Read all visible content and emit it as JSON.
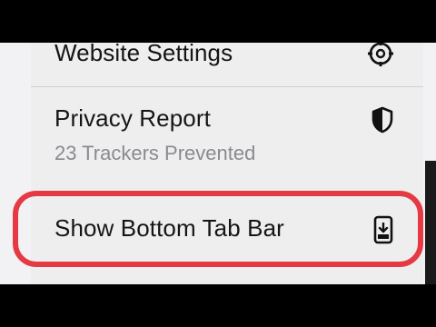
{
  "menu": {
    "items": [
      {
        "label": "Website Settings",
        "icon": "gear-icon"
      },
      {
        "label": "Privacy Report",
        "sublabel": "23 Trackers Prevented",
        "icon": "shield-half-icon"
      },
      {
        "label": "Show Bottom Tab Bar",
        "icon": "phone-arrow-down-icon"
      }
    ],
    "highlight_color": "#e53a44"
  }
}
